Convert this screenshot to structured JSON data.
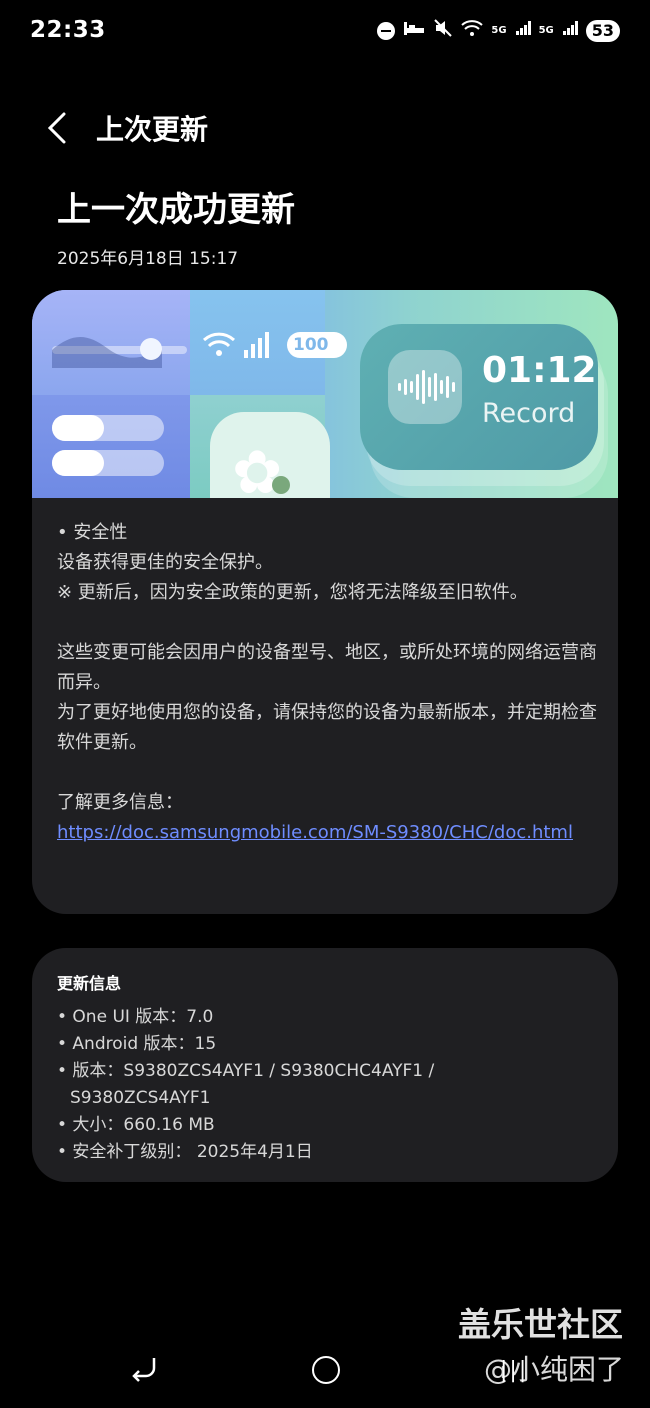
{
  "status_bar": {
    "time": "22:33",
    "net1": "5G",
    "net2": "5G",
    "battery": "53"
  },
  "header": {
    "title": "上次更新"
  },
  "page": {
    "title": "上一次成功更新",
    "date": "2025年6月18日 15:17"
  },
  "banner": {
    "battery_text": "100",
    "record_time": "01:12",
    "record_label": "Record"
  },
  "card1": {
    "line1": "• 安全性",
    "line2": "设备获得更佳的安全保护。",
    "line3": "※ 更新后，因为安全政策的更新，您将无法降级至旧软件。",
    "para2": "这些变更可能会因用户的设备型号、地区，或所处环境的网络运营商而异。",
    "para3": "为了更好地使用您的设备，请保持您的设备为最新版本，并定期检查软件更新。",
    "more_label": "了解更多信息：",
    "link": "https://doc.samsungmobile.com/SM-S9380/CHC/doc.html"
  },
  "update_info": {
    "title": "更新信息",
    "oneui": "• One UI 版本：7.0",
    "android": "• Android 版本：15",
    "version_a": "• 版本：S9380ZCS4AYF1 / S9380CHC4AYF1 /",
    "version_b": "S9380ZCS4AYF1",
    "size": "• 大小：660.16 MB",
    "patch": "• 安全补丁级别： 2025年4月1日"
  },
  "watermark": {
    "line1": "盖乐世社区",
    "line2": "@小纯困了"
  },
  "icons": [
    "dnd-icon",
    "bed-icon",
    "mute-icon",
    "wifi-icon",
    "signal-icon",
    "back-arrow-icon",
    "nav-back-icon",
    "nav-home-icon",
    "nav-recent-icon"
  ]
}
